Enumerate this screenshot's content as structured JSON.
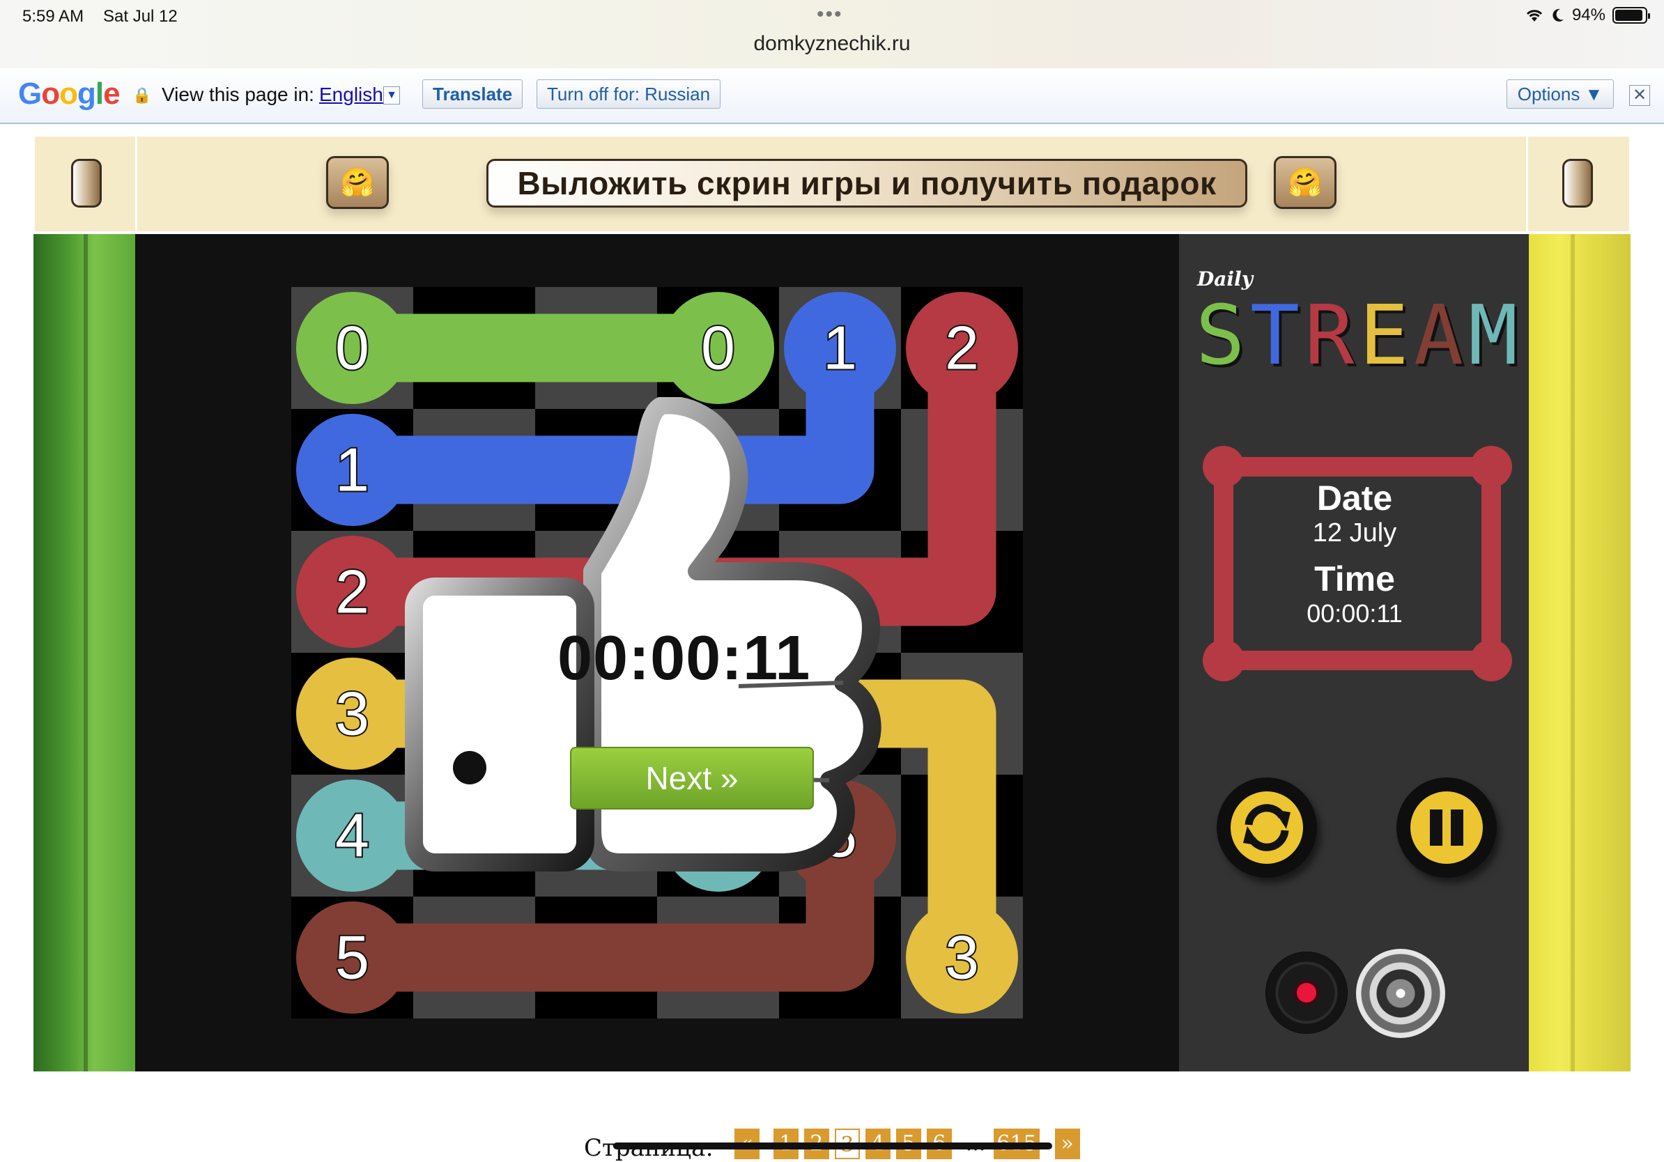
{
  "status_bar": {
    "time": "5:59 AM",
    "date": "Sat Jul 12",
    "battery": "94%",
    "battery_level": 0.94,
    "url": "domkyznechik.ru"
  },
  "translate_bar": {
    "view_label": "View this page in:",
    "language": "English",
    "translate_button": "Translate",
    "turn_off_button": "Turn off for: Russian",
    "options_button": "Options ▼",
    "close": "✕"
  },
  "banner": {
    "title": "Выложить скрин игры и получить подарок",
    "emoji": "🤗"
  },
  "board": {
    "size": 6,
    "colors": {
      "0": "#7cc04b",
      "1": "#4169df",
      "2": "#b53a43",
      "3": "#e5bf3f",
      "4": "#6fb8b8",
      "5": "#823e34"
    },
    "endpoints": [
      {
        "label": "0",
        "color": "0",
        "r": 0,
        "c": 0
      },
      {
        "label": "0",
        "color": "0",
        "r": 0,
        "c": 3
      },
      {
        "label": "1",
        "color": "1",
        "r": 0,
        "c": 4
      },
      {
        "label": "2",
        "color": "2",
        "r": 0,
        "c": 5
      },
      {
        "label": "1",
        "color": "1",
        "r": 1,
        "c": 0
      },
      {
        "label": "2",
        "color": "2",
        "r": 2,
        "c": 0
      },
      {
        "label": "3",
        "color": "3",
        "r": 3,
        "c": 0
      },
      {
        "label": "4",
        "color": "4",
        "r": 4,
        "c": 0
      },
      {
        "label": "5",
        "color": "5",
        "r": 4,
        "c": 4
      },
      {
        "label": "",
        "color": "4",
        "r": 4,
        "c": 3
      },
      {
        "label": "5",
        "color": "5",
        "r": 5,
        "c": 0
      },
      {
        "label": "3",
        "color": "3",
        "r": 5,
        "c": 5
      }
    ],
    "paths": [
      {
        "color": "0",
        "cells": [
          [
            0,
            0
          ],
          [
            0,
            1
          ],
          [
            0,
            2
          ],
          [
            0,
            3
          ]
        ]
      },
      {
        "color": "1",
        "cells": [
          [
            1,
            0
          ],
          [
            1,
            1
          ],
          [
            1,
            2
          ],
          [
            1,
            3
          ],
          [
            1,
            4
          ],
          [
            0,
            4
          ]
        ]
      },
      {
        "color": "2",
        "cells": [
          [
            2,
            0
          ],
          [
            2,
            1
          ],
          [
            2,
            2
          ],
          [
            2,
            3
          ],
          [
            2,
            4
          ],
          [
            2,
            5
          ],
          [
            1,
            5
          ],
          [
            0,
            5
          ]
        ]
      },
      {
        "color": "3",
        "cells": [
          [
            3,
            0
          ],
          [
            3,
            1
          ],
          [
            3,
            2
          ],
          [
            3,
            3
          ],
          [
            3,
            4
          ],
          [
            3,
            5
          ],
          [
            4,
            5
          ],
          [
            5,
            5
          ]
        ]
      },
      {
        "color": "4",
        "cells": [
          [
            4,
            0
          ],
          [
            4,
            1
          ],
          [
            4,
            2
          ],
          [
            4,
            3
          ]
        ]
      },
      {
        "color": "5",
        "cells": [
          [
            5,
            0
          ],
          [
            5,
            1
          ],
          [
            5,
            2
          ],
          [
            5,
            3
          ],
          [
            5,
            4
          ],
          [
            4,
            4
          ]
        ]
      }
    ]
  },
  "sidebar": {
    "logo_small": "Daily",
    "logo_letters": [
      {
        "ch": "S",
        "color": "#7cc04b"
      },
      {
        "ch": "T",
        "color": "#4169df"
      },
      {
        "ch": "R",
        "color": "#b53a43"
      },
      {
        "ch": "E",
        "color": "#e5bf3f"
      },
      {
        "ch": "A",
        "color": "#823e34"
      },
      {
        "ch": "M",
        "color": "#6fb8b8"
      }
    ],
    "date_label": "Date",
    "date_value": "12 July",
    "time_label": "Time",
    "time_value": "00:00:11",
    "restart_icon": "refresh-icon",
    "pause_icon": "pause-icon"
  },
  "win_overlay": {
    "time": "00:00:11",
    "next_button": "Next »"
  },
  "pagination": {
    "label": "Страница:",
    "prev": "«",
    "pages": [
      "1",
      "2",
      "3",
      "4",
      "5",
      "6"
    ],
    "current": "3",
    "ellipsis": "...",
    "last": "615",
    "next": "»"
  }
}
